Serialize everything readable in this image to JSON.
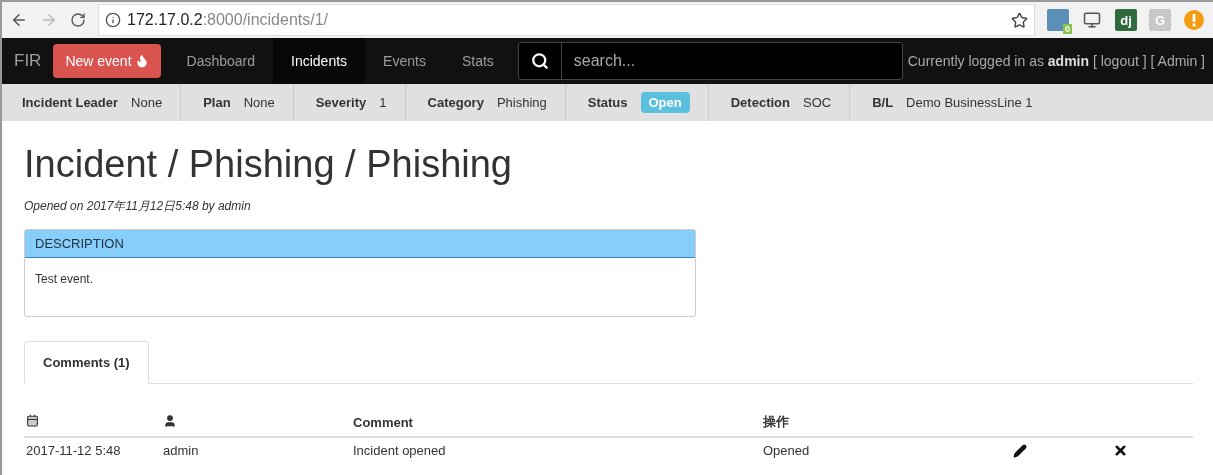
{
  "browser": {
    "url_host": "172.17.0.2",
    "url_path": ":8000/incidents/1/",
    "bookmarked": false,
    "extensions": [
      {
        "kind": "badge",
        "label": "0"
      },
      {
        "kind": "monitor"
      },
      {
        "kind": "letters",
        "label": "dj",
        "color": "#2f6b3f"
      },
      {
        "kind": "letters",
        "label": "G",
        "color": "#c8c8c8"
      },
      {
        "kind": "alert"
      }
    ]
  },
  "navbar": {
    "brand": "FIR",
    "new_button": "New event",
    "items": [
      {
        "label": "Dashboard",
        "selected": false
      },
      {
        "label": "Incidents",
        "selected": true
      },
      {
        "label": "Events",
        "selected": false
      },
      {
        "label": "Stats",
        "selected": false
      }
    ],
    "search": {
      "placeholder": "search..."
    },
    "user": {
      "prefix": "Currently logged in as",
      "name": "admin",
      "links": [
        "[ logout ]",
        "[ Admin ]"
      ]
    }
  },
  "info_bar": [
    {
      "label": "Incident Leader",
      "value": "None",
      "kind": "text"
    },
    {
      "label": "Plan",
      "value": "None",
      "kind": "text"
    },
    {
      "label": "Severity",
      "value": "1",
      "kind": "text"
    },
    {
      "label": "Category",
      "value": "Phishing",
      "kind": "text"
    },
    {
      "label": "Status",
      "value": "Open",
      "kind": "label"
    },
    {
      "label": "Detection",
      "value": "SOC",
      "kind": "text"
    },
    {
      "label": "B/L",
      "value": "Demo BusinessLine 1",
      "kind": "text"
    }
  ],
  "title": "Incident / Phishing / Phishing",
  "opened": "Opened on 2017年11月12日5:48 by admin",
  "description": {
    "heading": "DESCRIPTION",
    "body": "Test event."
  },
  "tabs": [
    {
      "label": "Comments (1)",
      "selected": true
    }
  ],
  "comments": {
    "columns": [
      {
        "kind": "date-icon"
      },
      {
        "kind": "user-icon"
      },
      {
        "kind": "text",
        "label": "Comment"
      },
      {
        "kind": "text",
        "label": "操作"
      }
    ],
    "rows": [
      {
        "date": "2017-11-12 5:48",
        "user": "admin",
        "comment": "Incident opened",
        "action": "Opened"
      }
    ]
  }
}
